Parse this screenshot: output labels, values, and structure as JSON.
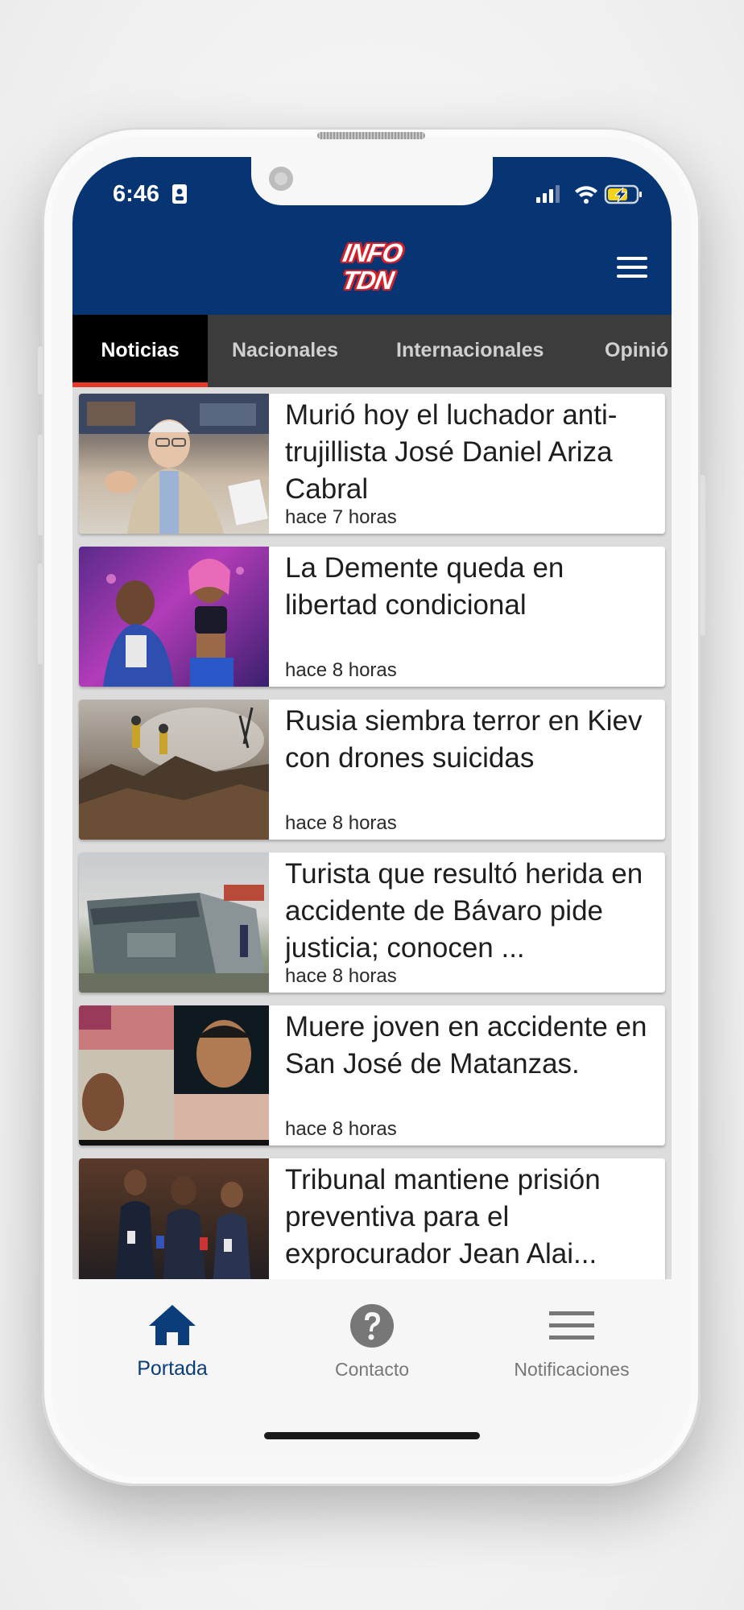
{
  "status_bar": {
    "time": "6:46"
  },
  "app": {
    "logo_line1": "INFO",
    "logo_line2": "TDN",
    "header_color": "#073574"
  },
  "tabs": [
    {
      "label": "Noticias",
      "active": true
    },
    {
      "label": "Nacionales",
      "active": false
    },
    {
      "label": "Internacionales",
      "active": false
    },
    {
      "label": "Opinió",
      "active": false
    }
  ],
  "articles": [
    {
      "title": "Murió hoy el luchador anti-trujillista José Daniel Ariza Cabral",
      "time": "hace 7 horas",
      "thumb_icon": "elderly-man-photo"
    },
    {
      "title": "La Demente queda en libertad condicional",
      "time": "hace 8 horas",
      "thumb_icon": "artists-photo"
    },
    {
      "title": "Rusia siembra terror en Kiev con drones suicidas",
      "time": "hace 8 horas",
      "thumb_icon": "rubble-photo"
    },
    {
      "title": "Turista que resultó herida en accidente de Bávaro pide justicia; conocen ...",
      "time": "hace 8 horas",
      "thumb_icon": "overturned-bus-photo"
    },
    {
      "title": "Muere joven en accidente en San José de Matanzas.",
      "time": "hace 8 horas",
      "thumb_icon": "collage-photo"
    },
    {
      "title": "Tribunal mantiene prisión preventiva para el exprocurador Jean Alai...",
      "time": "",
      "thumb_icon": "press-crowd-photo"
    }
  ],
  "bottom_nav": {
    "home": "Portada",
    "contact": "Contacto",
    "notifications": "Notificaciones",
    "active_color": "#0b3d7a",
    "inactive_color": "#777777"
  }
}
